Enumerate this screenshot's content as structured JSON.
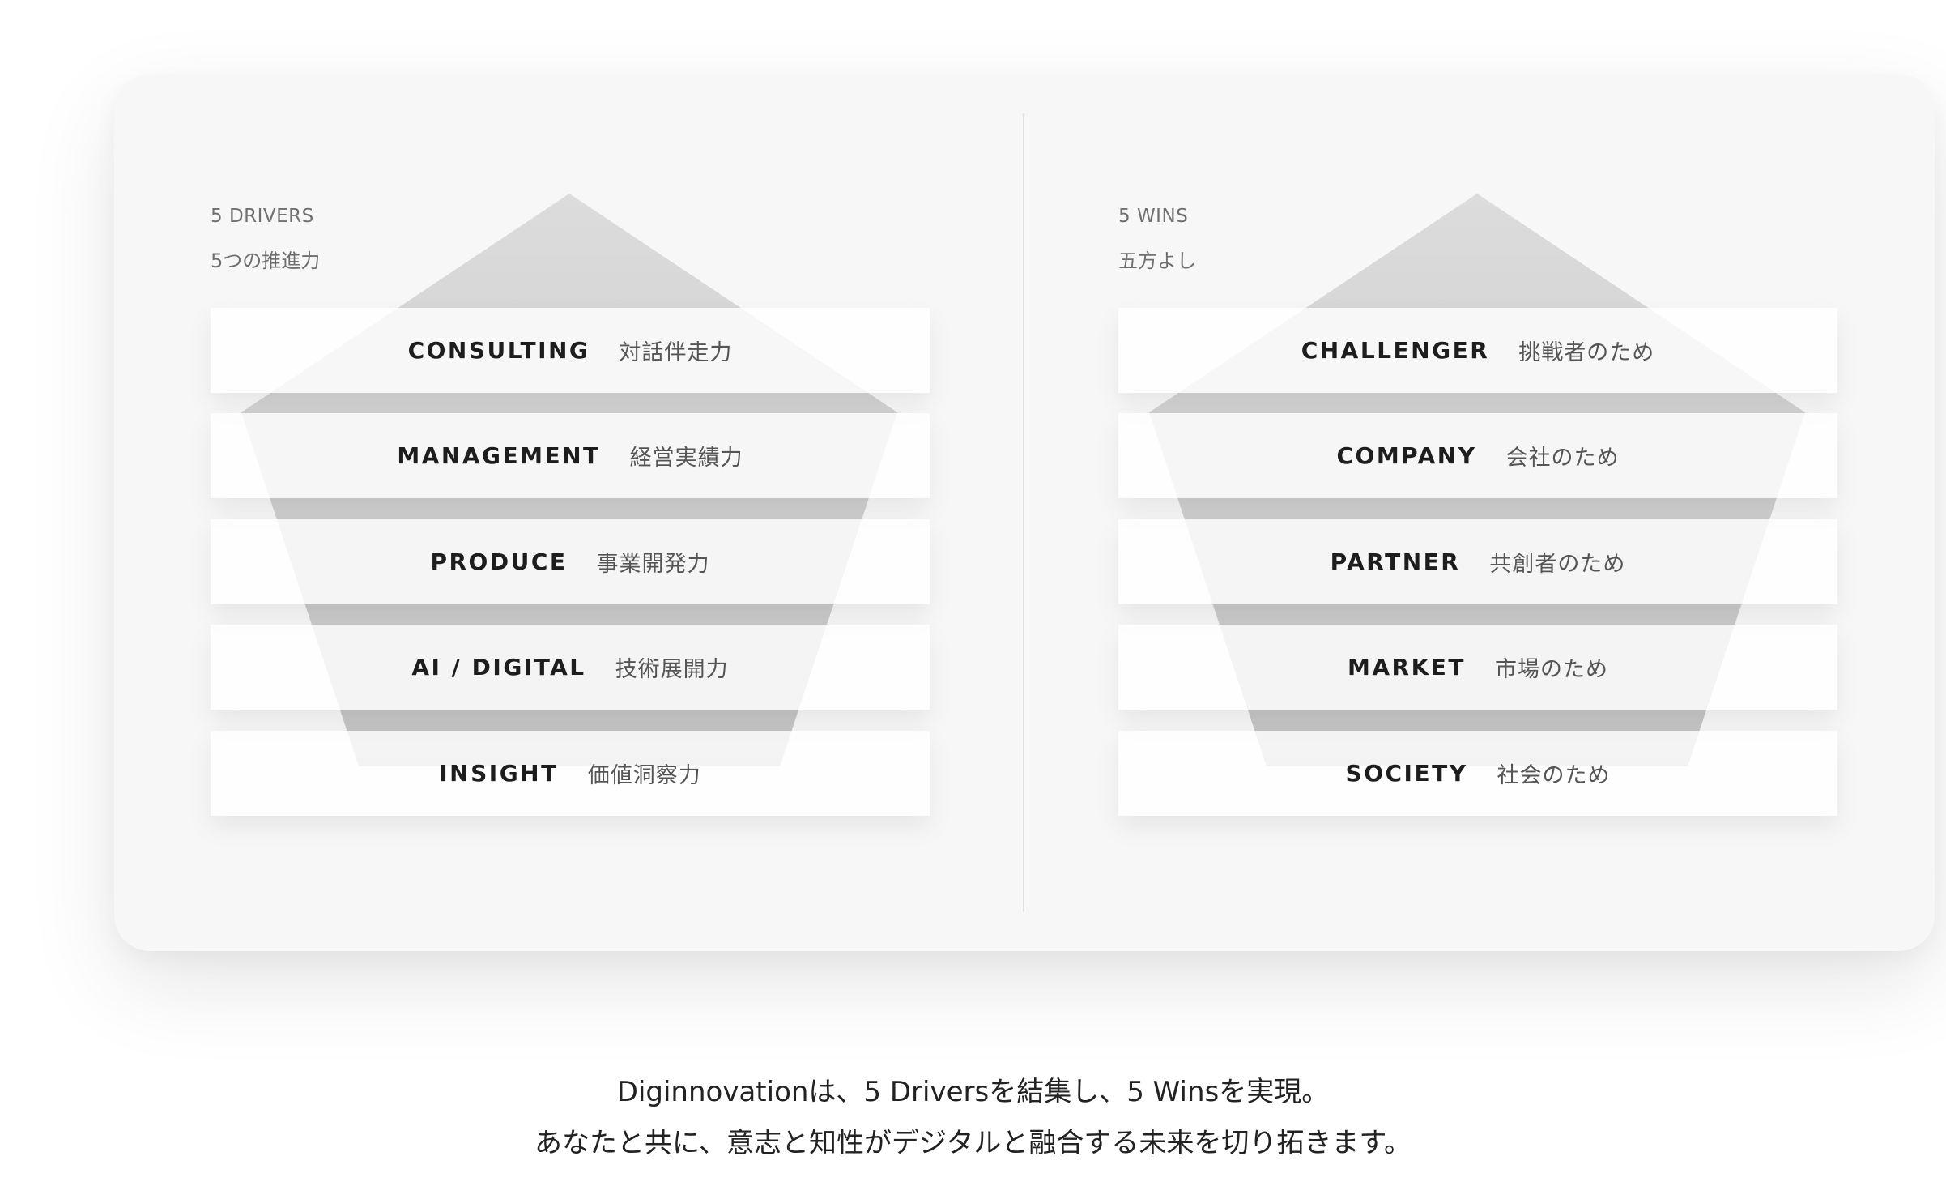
{
  "drivers": {
    "label_en": "5 DRIVERS",
    "label_jp": "5つの推進力",
    "items": [
      {
        "en": "CONSULTING",
        "jp": "対話伴走力"
      },
      {
        "en": "MANAGEMENT",
        "jp": "経営実績力"
      },
      {
        "en": "PRODUCE",
        "jp": "事業開発力"
      },
      {
        "en": "AI / DIGITAL",
        "jp": "技術展開力"
      },
      {
        "en": "INSIGHT",
        "jp": "価値洞察力"
      }
    ]
  },
  "wins": {
    "label_en": "5 WINS",
    "label_jp": "五方よし",
    "items": [
      {
        "en": "CHALLENGER",
        "jp": "挑戦者のため"
      },
      {
        "en": "COMPANY",
        "jp": "会社のため"
      },
      {
        "en": "PARTNER",
        "jp": "共創者のため"
      },
      {
        "en": "MARKET",
        "jp": "市場のため"
      },
      {
        "en": "SOCIETY",
        "jp": "社会のため"
      }
    ]
  },
  "tagline": {
    "line1": "Diginnovationは、5 Driversを結集し、5 Winsを実現。",
    "line2": "あなたと共に、意志と知性がデジタルと融合する未来を切り拓きます。"
  },
  "colors": {
    "panel_bg": "#f7f7f7",
    "pentagon_fill": "#c8c8c8",
    "card_bg": "#ffffff",
    "text_dark": "#1d1d1d",
    "text_muted": "#6f6f6f"
  }
}
